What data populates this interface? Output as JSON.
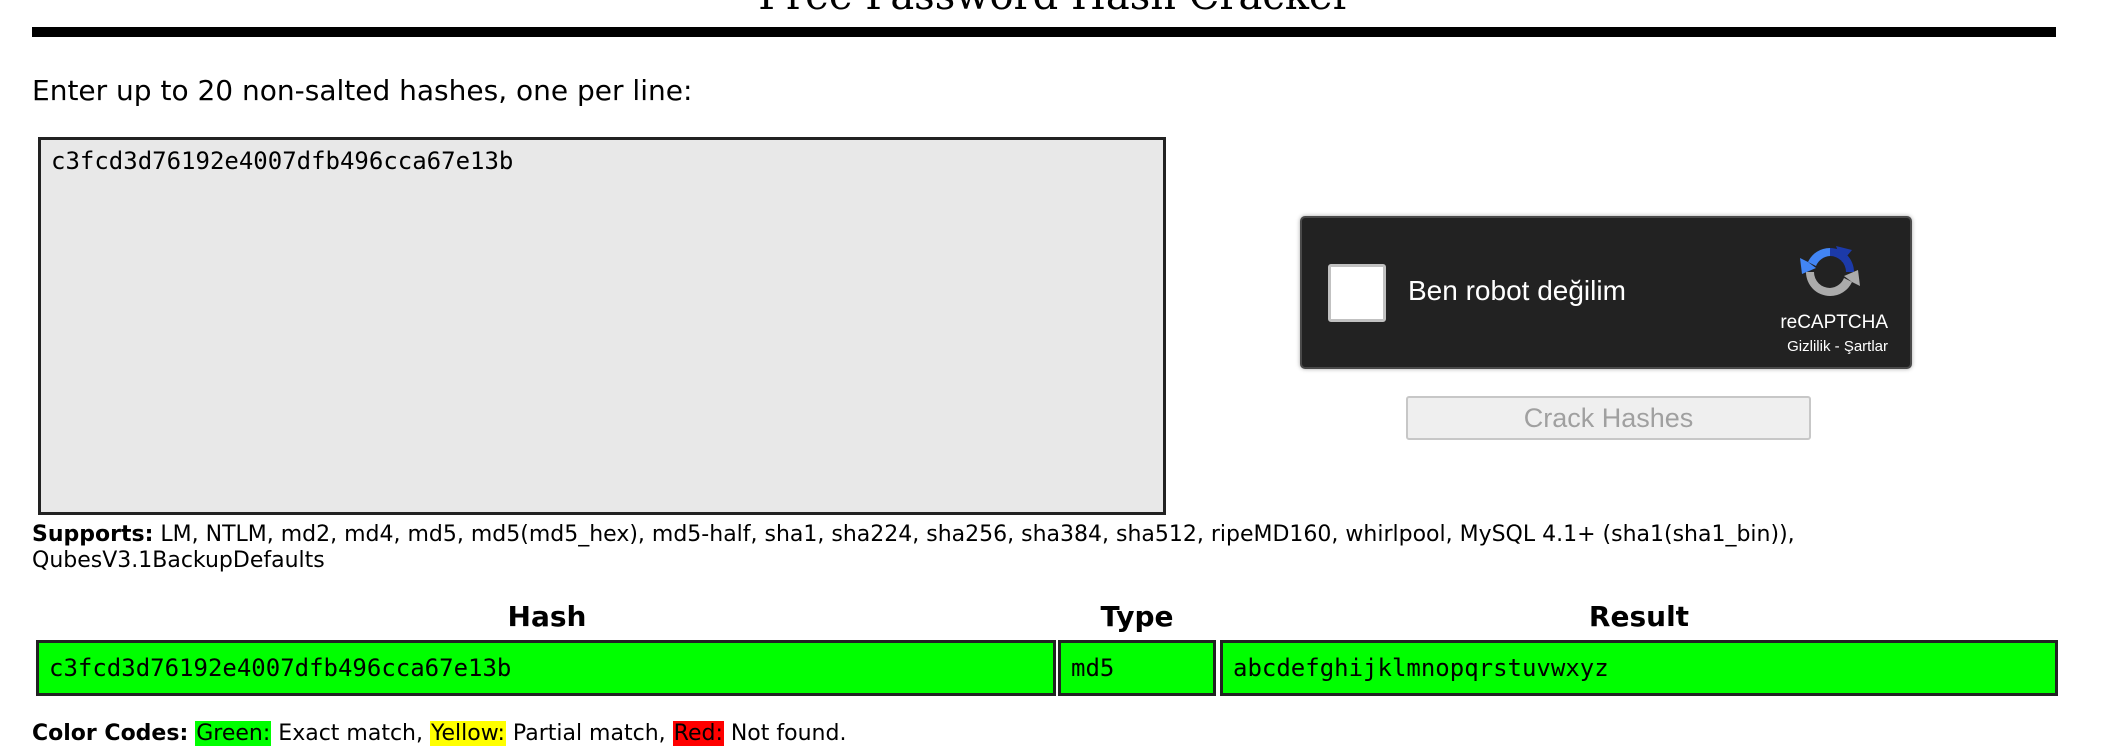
{
  "page": {
    "title": "Free Password Hash Cracker",
    "instructions": "Enter up to 20 non-salted hashes, one per line:"
  },
  "hash_input": {
    "value": "c3fcd3d76192e4007dfb496cca67e13b"
  },
  "recaptcha": {
    "checkbox_label": "Ben robot değilim",
    "brand": "reCAPTCHA",
    "privacy_link": "Gizlilik",
    "separator": " - ",
    "terms_link": "Şartlar",
    "logo_icon": "recaptcha-logo-icon"
  },
  "crack_button": {
    "label": "Crack Hashes",
    "enabled": false
  },
  "supports": {
    "label": "Supports:",
    "text": " LM, NTLM, md2, md4, md5, md5(md5_hex), md5-half, sha1, sha224, sha256, sha384, sha512, ripeMD160, whirlpool, MySQL 4.1+ (sha1(sha1_bin)), QubesV3.1BackupDefaults"
  },
  "results_table": {
    "columns": [
      "Hash",
      "Type",
      "Result"
    ],
    "rows": [
      {
        "hash": "c3fcd3d76192e4007dfb496cca67e13b",
        "type": "md5",
        "result": "abcdefghijklmnopqrstuvwxyz",
        "status_color": "#00ff00"
      }
    ]
  },
  "color_codes": {
    "label": "Color Codes:",
    "green": {
      "name": "Green:",
      "meaning": " Exact match,",
      "color": "#00ff00"
    },
    "yellow": {
      "name": "Yellow:",
      "meaning": " Partial match,",
      "color": "#ffff00"
    },
    "red": {
      "name": "Red:",
      "meaning": " Not found.",
      "color": "#ff0000"
    }
  }
}
